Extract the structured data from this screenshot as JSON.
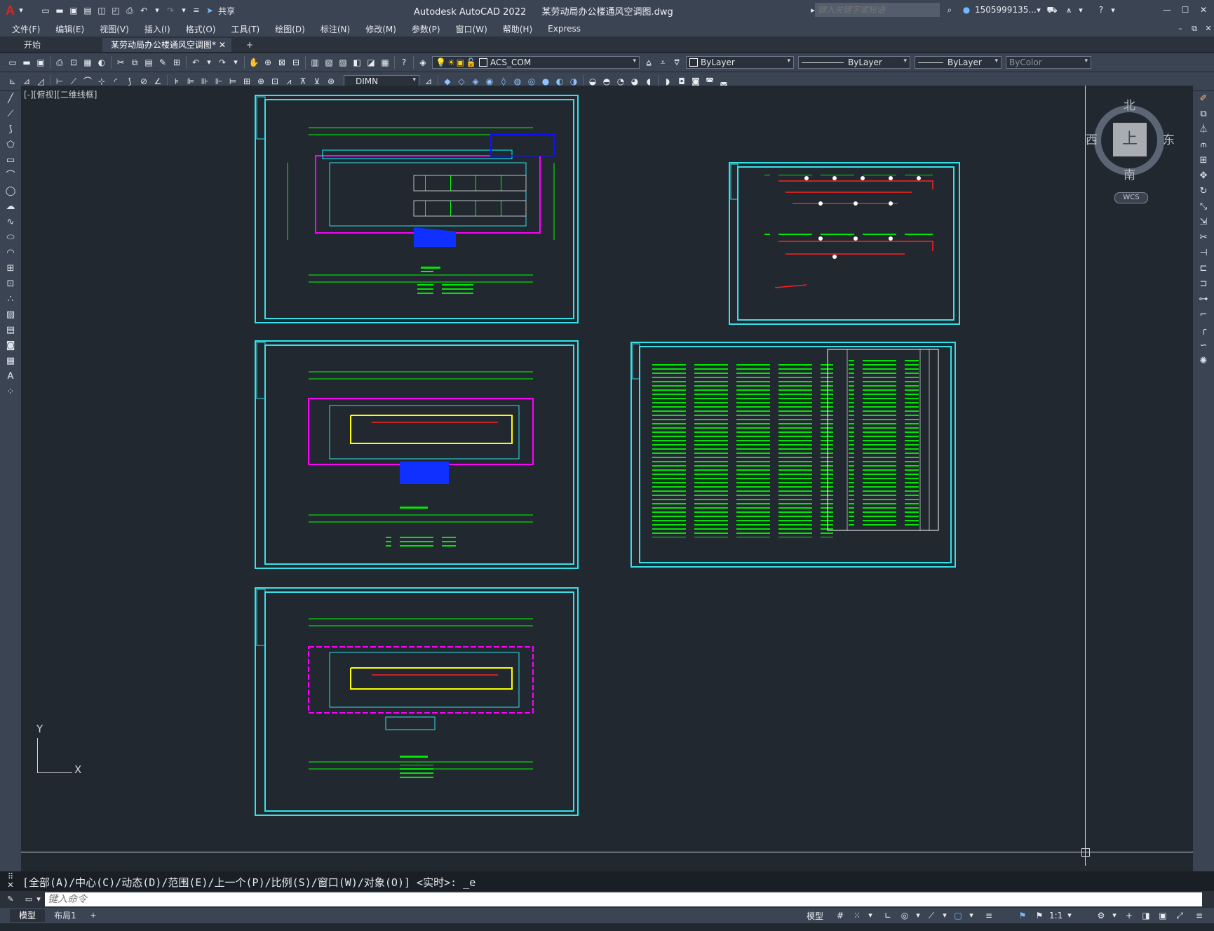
{
  "app": {
    "title": "Autodesk AutoCAD 2022",
    "file": "某劳动局办公楼通风空调图.dwg",
    "search_placeholder": "键入关键字或短语",
    "user": "1505999135...",
    "share_label": "共享",
    "logo": "A"
  },
  "menu": [
    "文件(F)",
    "编辑(E)",
    "视图(V)",
    "插入(I)",
    "格式(O)",
    "工具(T)",
    "绘图(D)",
    "标注(N)",
    "修改(M)",
    "参数(P)",
    "窗口(W)",
    "帮助(H)",
    "Express"
  ],
  "tabs": {
    "start": "开始",
    "doc": "某劳动局办公楼通风空调图*",
    "add": "+"
  },
  "toolbar": {
    "layer": "ACS_COM",
    "color": "ByLayer",
    "linetype": "ByLayer",
    "lineweight": "ByLayer",
    "plotstyle": "ByColor",
    "dimstyle": "DIMN"
  },
  "viewport": {
    "label": "[-][俯视][二维线框]"
  },
  "viewcube": {
    "north": "北",
    "south": "南",
    "east": "东",
    "west": "西",
    "top": "上",
    "wcs": "WCS"
  },
  "ucs": {
    "x": "X",
    "y": "Y"
  },
  "command": {
    "history": "[全部(A)/中心(C)/动态(D)/范围(E)/上一个(P)/比例(S)/窗口(W)/对象(O)] <实时>: _e",
    "placeholder": "键入命令"
  },
  "status": {
    "model_tab": "模型",
    "layout_tab": "布局1",
    "model_btn": "模型",
    "scale": "1:1"
  },
  "colors": {
    "cyan": "#35e1e8",
    "green": "#00ff00",
    "magenta": "#ff00ff",
    "yellow": "#ffff00",
    "red": "#ff2020",
    "blue": "#1010ff",
    "bg": "#212830"
  },
  "icons": [
    "autocad-logo-icon",
    "new-icon",
    "open-icon",
    "save-icon",
    "print-icon",
    "undo-icon",
    "redo-icon",
    "share-icon",
    "search-icon",
    "user-icon",
    "cart-icon",
    "help-icon",
    "minimize-icon",
    "maximize-icon",
    "close-icon"
  ]
}
